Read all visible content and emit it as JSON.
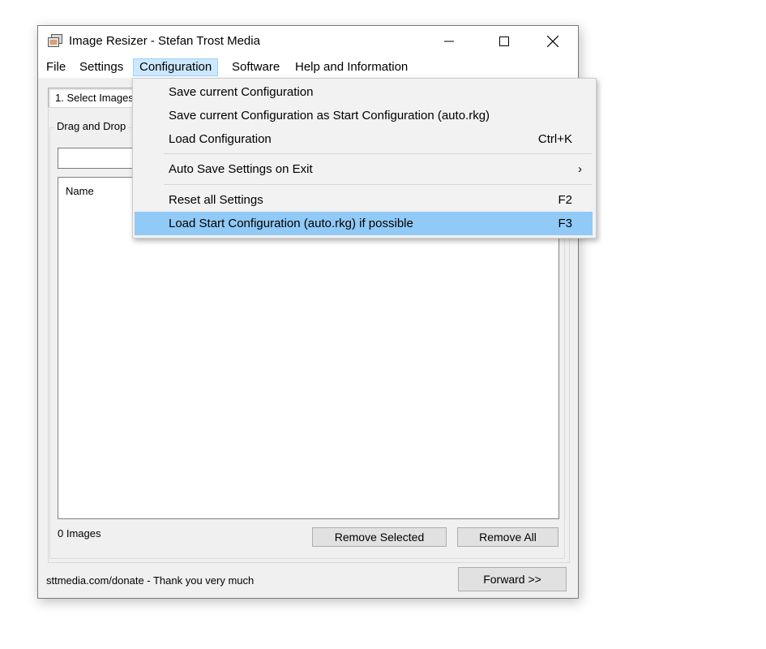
{
  "window": {
    "title": "Image Resizer - Stefan Trost Media",
    "controls": {
      "minimize": "minimize-icon",
      "maximize": "maximize-icon",
      "close": "close-icon"
    }
  },
  "menubar": {
    "items": [
      {
        "label": "File"
      },
      {
        "label": "Settings"
      },
      {
        "label": "Configuration",
        "active": true
      },
      {
        "label": "Software"
      },
      {
        "label": "Help and Information"
      }
    ]
  },
  "tab": {
    "label": "1. Select Images"
  },
  "group": {
    "label": "Drag and Drop"
  },
  "path_input": {
    "value": ""
  },
  "list": {
    "columns": [
      "Name"
    ],
    "rows": []
  },
  "status": {
    "count_text": "0 Images"
  },
  "buttons": {
    "remove_selected": "Remove Selected",
    "remove_all": "Remove All",
    "forward": "Forward >>"
  },
  "footer": {
    "text": "sttmedia.com/donate - Thank you very much"
  },
  "dropdown": {
    "items": [
      {
        "label": "Save current Configuration",
        "shortcut": ""
      },
      {
        "label": "Save current Configuration as Start Configuration (auto.rkg)",
        "shortcut": ""
      },
      {
        "label": "Load Configuration",
        "shortcut": "Ctrl+K"
      },
      {
        "label": "Auto Save Settings on Exit",
        "shortcut": "›",
        "submenu": true
      },
      {
        "label": "Reset all Settings",
        "shortcut": "F2"
      },
      {
        "label": "Load Start Configuration (auto.rkg) if possible",
        "shortcut": "F3",
        "highlighted": true
      }
    ]
  },
  "colors": {
    "highlight": "#91c9f7",
    "menu_active": "#cce8ff",
    "window_bg": "#f0f0f0"
  }
}
